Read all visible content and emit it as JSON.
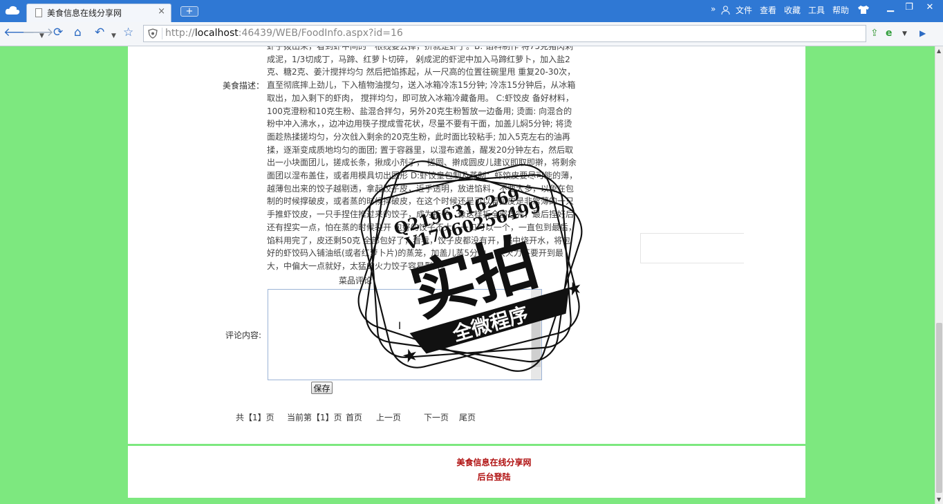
{
  "browser": {
    "tab_title": "美食信息在线分享网",
    "tab_close": "×",
    "new_tab": "+",
    "menu": {
      "more": "»",
      "file": "文件",
      "view": "查看",
      "favorites": "收藏",
      "tools": "工具",
      "help": "帮助"
    },
    "url_prefix": "http://",
    "url_host": "localhost",
    "url_rest": ":46439/WEB/FoodInfo.aspx?id=16"
  },
  "food": {
    "desc_label": "美食描述：",
    "desc_text": "虾子拨出来，看到虾中间的一根线要去掉，挤就是虾了。B: 馅料制作 将75克猪肉剁成泥，1/3切成丁，马蹄、红萝卜切碎， 剁成泥的虾泥中加入马蹄红萝卜，加入盐2克、糖2克、姜汁搅拌均匀 然后把馅拣起，从一尺高的位置往碗里甩 重复20-30次，直至彻底摔上劲儿，下入植物油搅匀，送入冰箱冷冻15分钟; 冷冻15分钟后，从冰箱取出，加入剩下的虾肉， 搅拌均匀，即可放入冰箱冷藏备用。 C:虾饺皮 备好材料，100克澄粉和10克生粉、盐混合拌匀，另外20克生粉暂放一边备用; 烫面: 向混合的粉中冲入沸水，，边冲边用筷子搅成雪花状，尽量不要有干面，加盖儿焖5分钟; 将烫面趁热揉搓均匀，分次戗入剩余的20克生粉，此时面比较粘手; 加入5克左右的油再揉，逐渐变成质地均匀的面团; 置于容器里，以湿布遮盖，醒发20分钟左右，然后取出一小块面团儿，搓成长条，揪成小剂子， 搓圆、擀成圆皮儿建议即取即擀，将剩余面团以湿布盖住，或者用模具切出圆形 D:虾饺皇包制及蒸制：虾饺皮要尽可能的薄，越薄包出来的饺子越剔透，拿起饺子皮，近乎透明，放进馅料，不要太多，以免在包制的时候撑破皮，或者蒸的时候撑破皮，在这个时候还是可以看见皮是非常薄的一只手推虾饺皮，一只手捏住推过来的饺子，成为折子，像这样折全部捏完，最后捏好后还有捏实一点，怕在蒸的时候裂开 包好的饺子不大，一口可以一个，一直包到最后，馅料用完了，皮还剩50克 全部包好了，看看，饺子皮都没有开，锅中烧开水，将包好的虾饺码入铺油纸(或者红萝卜片)的蒸笼，加盖儿蒸5分钟， 大火力不要开到最大，中偏大一点就好，太猛的火力饺子容易裂开。"
  },
  "comment": {
    "title": "菜品评论",
    "label": "评论内容:",
    "value": "",
    "save": "保存"
  },
  "pager": {
    "total": "共【1】页",
    "current": "当前第【1】页",
    "first": "首页",
    "prev": "上一页",
    "next": "下一页",
    "last": "尾页"
  },
  "footer": {
    "site_name": "美食信息在线分享网",
    "admin_login": "后台登陆"
  },
  "watermark": {
    "qq": "Q2196316269",
    "phone": "V17060256499",
    "main": "实拍",
    "sub": "全微程序"
  },
  "colors": {
    "titlebar": "#2f78d4",
    "page_bg": "#7de87f",
    "footer_text": "#b01111"
  }
}
